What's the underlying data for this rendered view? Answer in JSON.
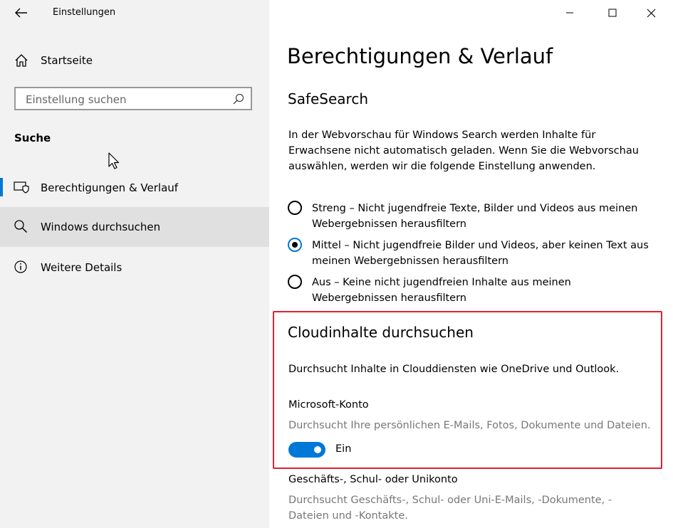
{
  "window": {
    "title": "Einstellungen"
  },
  "sidebar": {
    "home_label": "Startseite",
    "search_placeholder": "Einstellung suchen",
    "section_label": "Suche",
    "items": [
      {
        "label": "Berechtigungen & Verlauf",
        "icon": "permissions-history-icon",
        "active": true
      },
      {
        "label": "Windows durchsuchen",
        "icon": "search-icon",
        "active": false
      },
      {
        "label": "Weitere Details",
        "icon": "info-icon",
        "active": false
      }
    ]
  },
  "main": {
    "page_title": "Berechtigungen & Verlauf",
    "safesearch": {
      "heading": "SafeSearch",
      "description": "In der Webvorschau für Windows Search werden Inhalte für Erwachsene nicht automatisch geladen. Wenn Sie die Webvorschau auswählen, werden wir die folgende Einstellung anwenden.",
      "options": [
        {
          "line1": "Streng – Nicht jugendfreie Texte, Bilder und Videos aus meinen",
          "line2": "Webergebnissen herausfiltern",
          "selected": false
        },
        {
          "line1": "Mittel – Nicht jugendfreie Bilder und Videos, aber keinen Text aus",
          "line2": "meinen Webergebnissen herausfiltern",
          "selected": true
        },
        {
          "line1": "Aus – Keine nicht jugendfreien Inhalte aus meinen",
          "line2": "Webergebnissen herausfiltern",
          "selected": false
        }
      ]
    },
    "cloud": {
      "heading": "Cloudinhalte durchsuchen",
      "description": "Durchsucht Inhalte in Clouddiensten wie OneDrive und Outlook.",
      "microsoft_account": {
        "label": "Microsoft-Konto",
        "description": "Durchsucht Ihre persönlichen E-Mails, Fotos, Dokumente und Dateien.",
        "toggle_state": "Ein",
        "toggle_on": true
      },
      "work_account": {
        "label": "Geschäfts-, Schul- oder Unikonto",
        "description_line1": "Durchsucht Geschäfts-, Schul- oder Uni-E-Mails, -Dokumente, -",
        "description_line2": "Dateien und -Kontakte."
      }
    }
  },
  "colors": {
    "accent": "#0078d7",
    "highlight": "#e02030",
    "sidebar_bg": "#f2f2f2"
  }
}
